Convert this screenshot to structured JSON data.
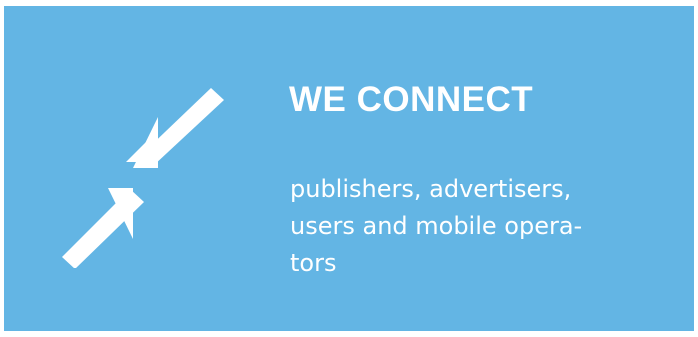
{
  "banner": {
    "headline": "WE CONNECT",
    "body_lines": [
      "publishers, advertisers,",
      "users and mobile opera-",
      "tors"
    ],
    "icon": "arrows-converge-icon",
    "colors": {
      "background": "#63b5e4",
      "text": "#ffffff"
    }
  }
}
